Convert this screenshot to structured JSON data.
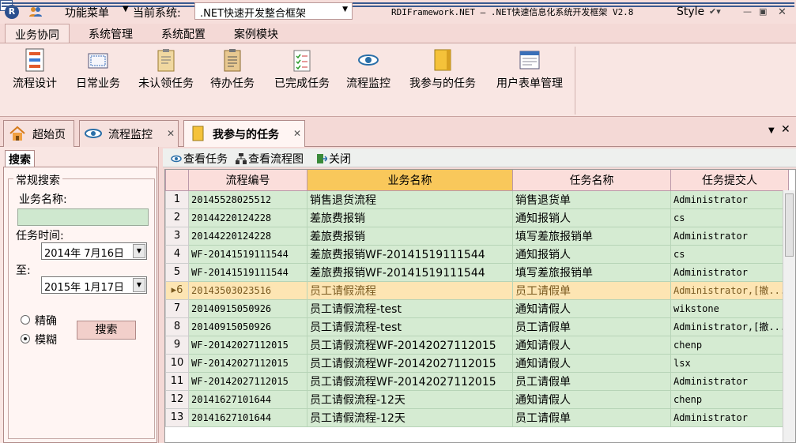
{
  "titlebar": {
    "function_menu": "功能菜单",
    "current_system_label": "当前系统:",
    "current_system_value": ".NET快速开发整合框架",
    "app_title": "RDIFramework.NET  —  .NET快速信息化系统开发框架  V2.8",
    "style_label": "Style"
  },
  "ribbon_tabs": [
    "业务协同",
    "系统管理",
    "系统配置",
    "案例模块"
  ],
  "ribbon_buttons": [
    "流程设计",
    "日常业务",
    "未认领任务",
    "待办任务",
    "已完成任务",
    "流程监控",
    "我参与的任务",
    "用户表单管理"
  ],
  "doc_tabs": [
    "超始页",
    "流程监控",
    "我参与的任务"
  ],
  "search_panel": {
    "tab": "搜索",
    "group_title": "常规搜索",
    "biz_name_label": "业务名称:",
    "biz_name_value": "",
    "time_label": "任务时间:",
    "start_date": "2014年  7月16日",
    "to_label": "至:",
    "end_date": "2015年  1月17日",
    "exact": "精确",
    "fuzzy": "模糊",
    "fuzzy_selected": true,
    "search_button": "搜索"
  },
  "toolbar": {
    "view_task": "查看任务",
    "view_flow": "查看流程图",
    "close": "关闭"
  },
  "table": {
    "columns": [
      "流程编号",
      "业务名称",
      "任务名称",
      "任务提交人"
    ],
    "selected_row": 6,
    "rows": [
      [
        "1",
        "20145528025512",
        "销售退货流程",
        "销售退货单",
        "Administrator"
      ],
      [
        "2",
        "20144220124228",
        "差旅费报销",
        "通知报销人",
        "cs"
      ],
      [
        "3",
        "20144220124228",
        "差旅费报销",
        "填写差旅报销单",
        "Administrator"
      ],
      [
        "4",
        "WF-20141519111544",
        "差旅费报销WF-20141519111544",
        "通知报销人",
        "cs"
      ],
      [
        "5",
        "WF-20141519111544",
        "差旅费报销WF-20141519111544",
        "填写差旅报销单",
        "Administrator"
      ],
      [
        "6",
        "20143503023516",
        "员工请假流程",
        "员工请假单",
        "Administrator,[撤..."
      ],
      [
        "7",
        "20140915050926",
        "员工请假流程-test",
        "通知请假人",
        "wikstone"
      ],
      [
        "8",
        "20140915050926",
        "员工请假流程-test",
        "员工请假单",
        "Administrator,[撤..."
      ],
      [
        "9",
        "WF-20142027112015",
        "员工请假流程WF-20142027112015",
        "通知请假人",
        "chenp"
      ],
      [
        "10",
        "WF-20142027112015",
        "员工请假流程WF-20142027112015",
        "通知请假人",
        "lsx"
      ],
      [
        "11",
        "WF-20142027112015",
        "员工请假流程WF-20142027112015",
        "员工请假单",
        "Administrator"
      ],
      [
        "12",
        "20141627101644",
        "员工请假流程-12天",
        "通知请假人",
        "chenp"
      ],
      [
        "13",
        "20141627101644",
        "员工请假流程-12天",
        "员工请假单",
        "Administrator"
      ]
    ]
  }
}
